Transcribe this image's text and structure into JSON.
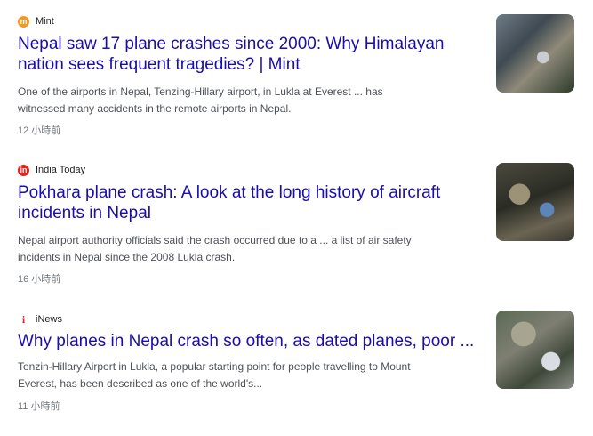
{
  "results": [
    {
      "source": "Mint",
      "source_icon": "mint-logo-icon",
      "source_icon_glyph": "m",
      "title": "Nepal saw 17 plane crashes since 2000: Why Himalayan nation sees frequent tragedies? | Mint",
      "title_lines": [
        "Nepal saw 17 plane crashes since 2000: Why Himalayan",
        "nation sees frequent tragedies? | Mint"
      ],
      "snippet_lines": [
        "One of the airports in Nepal, Tenzing-Hillary airport, in Lukla at Everest ... has",
        "witnessed many accidents in the remote airports in Nepal."
      ],
      "time": "12 小時前"
    },
    {
      "source": "India Today",
      "source_icon": "india-today-logo-icon",
      "source_icon_glyph": "in",
      "title_lines": [
        "Pokhara plane crash: A look at the long history of aircraft",
        "incidents in Nepal"
      ],
      "snippet_lines": [
        "Nepal airport authority officials said the crash occurred due to a ... a list of air safety",
        "incidents in Nepal since the 2008 Lukla crash."
      ],
      "time": "16 小時前"
    },
    {
      "source": "iNews",
      "source_icon": "inews-logo-icon",
      "source_icon_glyph": "i",
      "title_lines": [
        "Why planes in Nepal crash so often, as dated planes, poor ..."
      ],
      "snippet_lines": [
        "Tenzin-Hillary Airport in Lukla, a popular starting point for people travelling to Mount",
        "Everest, has been described as one of the world's..."
      ],
      "time": "11 小時前"
    }
  ],
  "colors": {
    "link": "#1a0dab",
    "snippet": "#4d5156",
    "meta": "#70757a"
  }
}
